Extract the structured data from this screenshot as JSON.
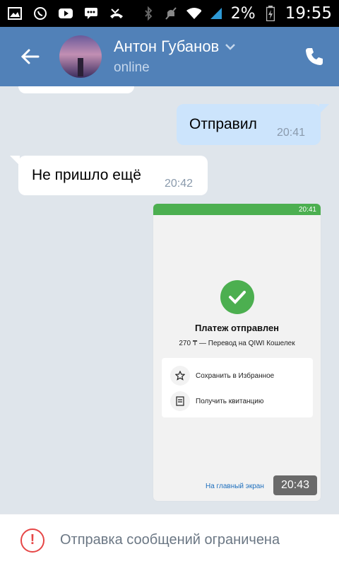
{
  "status_bar": {
    "battery_percent": "2%",
    "time": "19:55",
    "icons": [
      "gallery-icon",
      "whatsapp-icon",
      "youtube-icon",
      "message-icon",
      "missed-call-icon",
      "bluetooth-icon",
      "mute-icon",
      "wifi-icon",
      "signal-icon",
      "battery-icon"
    ]
  },
  "header": {
    "name": "Антон Губанов",
    "status": "online"
  },
  "messages": {
    "out1": {
      "text": "Отправил",
      "time": "20:41"
    },
    "in1": {
      "text": "Не пришло ещё",
      "time": "20:42"
    },
    "image": {
      "status_time": "20:41",
      "title": "Платеж отправлен",
      "subtitle": "270 ₸ — Перевод на QIWI Кошелек",
      "save_label": "Сохранить в Избранное",
      "receipt_label": "Получить квитанцию",
      "home_link": "На главный экран",
      "time": "20:43"
    }
  },
  "bottom": {
    "notice": "Отправка сообщений ограничена"
  },
  "colors": {
    "header_bg": "#5181b8",
    "outgoing_bubble": "#cce4fc",
    "success_green": "#4caf50",
    "alert_red": "#e64646"
  }
}
